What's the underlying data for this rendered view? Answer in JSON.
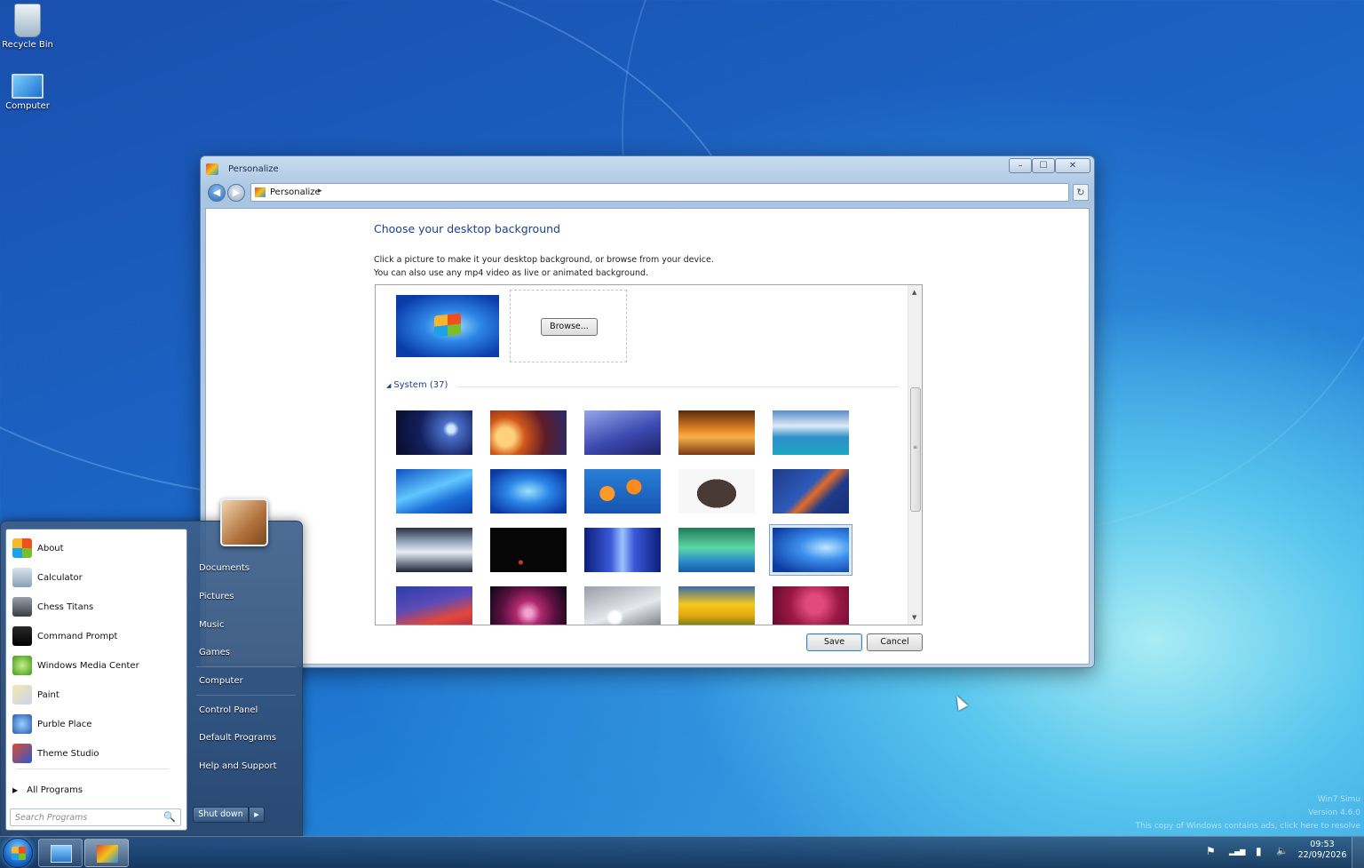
{
  "desktop": {
    "icons": [
      {
        "label": "Recycle Bin",
        "icon": "recycle-bin-icon"
      },
      {
        "label": "Computer",
        "icon": "computer-icon"
      }
    ],
    "watermark": [
      "Win7 Simu",
      "Version 4.6.0",
      "This copy of Windows contains ads, click here to resolve"
    ]
  },
  "window": {
    "title": "Personalize",
    "controls": {
      "minimize": "–",
      "maximize": "☐",
      "close": "✕"
    },
    "address": {
      "crumb": "Personalize",
      "arrow": "▸"
    },
    "heading": "Choose your desktop background",
    "description": [
      "Click a picture to make it your desktop background, or browse from your device.",
      "You can also use any mp4 video as live or animated background."
    ],
    "browse_label": "Browse...",
    "section_label": "System (37)",
    "section_arrow": "◢",
    "selected_index": 14,
    "save_label": "Save",
    "cancel_label": "Cancel"
  },
  "wallpapers": [
    {
      "name": "wallpaper-stars",
      "bg": "radial-gradient(circle at 72% 42%,#cfe8ff 0 4px,#4a6fc8 9px,#14205e 35px,#0a1034 60px)"
    },
    {
      "name": "wallpaper-space-needle",
      "bg": "radial-gradient(circle at 20% 60%,#ffd17a 0 10px,#d2571a 22px,#5e1c28 45px,#1d2e7a 80px)"
    },
    {
      "name": "wallpaper-moon-mountain",
      "bg": "linear-gradient(160deg,#95a6ea 0%,#3d4ab0 55%,#1c2266 100%)"
    },
    {
      "name": "wallpaper-autumn-road",
      "bg": "linear-gradient(180deg,#5a2a0c 0%,#e8892a 45%,#f6b24a 60%,#7a3a12 100%)"
    },
    {
      "name": "wallpaper-sea-clouds",
      "bg": "linear-gradient(180deg,#5a8dc8 0%,#dfe9f6 35%,#2e90c8 60%,#1da7c4 100%)"
    },
    {
      "name": "wallpaper-blue-wave",
      "bg": "linear-gradient(160deg,#0f52c4 0%,#62c6ff 45%,#1b6ed8 70%,#0a3fa8 100%)"
    },
    {
      "name": "wallpaper-windows-logo",
      "bg": "radial-gradient(ellipse at 50% 50%,#9be2ff 0%,#2b84e6 40%,#0a3aa4 85%)"
    },
    {
      "name": "wallpaper-goldfish",
      "bg": "radial-gradient(circle at 30% 55%,#ff9a28 0 8px,rgba(0,0,0,0) 9px),radial-gradient(circle at 65% 40%,#ff8a1e 0 8px,rgba(0,0,0,0) 9px),linear-gradient(180deg,#2a7fd6,#1554b0)"
    },
    {
      "name": "wallpaper-suitcase",
      "bg": "radial-gradient(ellipse 22px 16px at 50% 55%,#4a3a36 0 100%,rgba(0,0,0,0) 101%),#f7f7f7"
    },
    {
      "name": "wallpaper-abstract-orange",
      "bg": "linear-gradient(135deg,#1f3a8a 0%,#2d5ab8 45%,#e46a24 55%,#1f3a8a 70%,#16307a 100%)"
    },
    {
      "name": "wallpaper-icy-lake",
      "bg": "linear-gradient(180deg,#2a3040 0%,#8ea0b8 30%,#e8eef6 55%,#1a2436 100%)"
    },
    {
      "name": "wallpaper-dark",
      "bg": "radial-gradient(circle at 40% 78%,#c83a1e 0 2px,rgba(0,0,0,0) 3px),#060606"
    },
    {
      "name": "wallpaper-blue-light",
      "bg": "linear-gradient(90deg,#0c1e7a 0%,#3a5ad8 35%,#9cc4ff 50%,#3a5ad8 65%,#0c1e7a 100%)"
    },
    {
      "name": "wallpaper-aurora",
      "bg": "linear-gradient(180deg,#1e7a5a 0%,#5ed6a6 45%,#2a8ec8 75%,#1b5aa8 100%)"
    },
    {
      "name": "wallpaper-blue-glow",
      "bg": "radial-gradient(ellipse at 70% 45%,#bfe8ff 0%,#3b8fee 35%,#0c3a9e 85%)"
    },
    {
      "name": "wallpaper-red-blue-wave",
      "bg": "linear-gradient(165deg,#2d3ea8 0%,#5a4ab8 40%,#e2483a 70%,#a82a48 100%)"
    },
    {
      "name": "wallpaper-dahlia",
      "bg": "radial-gradient(circle at 50% 60%,#f4a0d0 0 4px,#b0286e 14px,#5a1040 30px,#120818 50px)"
    },
    {
      "name": "wallpaper-silver-bokeh",
      "bg": "radial-gradient(circle at 40% 70%,#ffffff 0 6px,rgba(255,255,255,0) 10px),linear-gradient(160deg,#9a9ea6,#e6e8ec 55%,#6a6e78)"
    },
    {
      "name": "wallpaper-yellow-tulips",
      "bg": "linear-gradient(180deg,#3a6aa8 0%,#f2c81e 40%,#e8a80e 65%,#3a6a1a 100%)"
    },
    {
      "name": "wallpaper-pink-jellyfish",
      "bg": "radial-gradient(circle at 55% 40%,#e04a7c 0 10px,#9a1844 28px,#5e0a2a 55px)"
    }
  ],
  "start_menu": {
    "programs": [
      {
        "label": "About",
        "icon": "windows-logo-icon",
        "bg": "conic-gradient(#f24f20 0 25%,#7cbd2a 0 50%,#1aa3e8 0 75%,#f7b62c 0 100%)"
      },
      {
        "label": "Calculator",
        "icon": "calculator-icon",
        "bg": "linear-gradient(#d8e2ec,#8aa0b8)"
      },
      {
        "label": "Chess Titans",
        "icon": "chess-piece-icon",
        "bg": "linear-gradient(#9aa0a8,#3a3e44)"
      },
      {
        "label": "Command Prompt",
        "icon": "command-prompt-icon",
        "bg": "linear-gradient(#2a2a2a,#000)"
      },
      {
        "label": "Windows Media Center",
        "icon": "media-center-icon",
        "bg": "radial-gradient(circle,#c6f08a,#3f9a1a)"
      },
      {
        "label": "Paint",
        "icon": "paint-icon",
        "bg": "linear-gradient(135deg,#f6e6b0,#c8d6ea)"
      },
      {
        "label": "Purble Place",
        "icon": "purble-place-icon",
        "bg": "radial-gradient(circle,#9ad0ff,#2a5ab0)"
      },
      {
        "label": "Theme Studio",
        "icon": "theme-studio-icon",
        "bg": "linear-gradient(135deg,#e04b2c,#2a5ad0)"
      }
    ],
    "all_programs": "All Programs",
    "all_programs_arrow": "▶",
    "search_placeholder": "Search Programs",
    "search_icon": "🔍",
    "places": [
      "Documents",
      "Pictures",
      "Music",
      "Games",
      "Computer",
      "Control Panel",
      "Default Programs",
      "Help and Support"
    ],
    "shutdown_label": "Shut down",
    "shutdown_arrow": "▶"
  },
  "taskbar": {
    "tray": {
      "flag": "⚑",
      "network": "▂▄▆",
      "power": "▮",
      "volume": "🔈"
    },
    "time": "09:53",
    "date": "22/09/2026"
  }
}
